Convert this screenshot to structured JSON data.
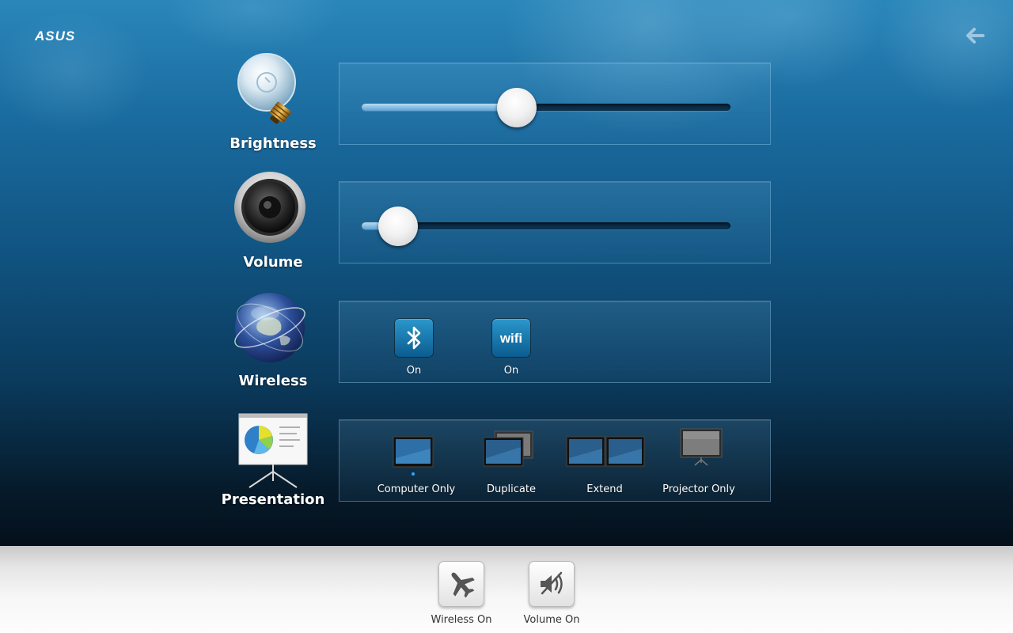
{
  "brand": {
    "logo_text": "ASUS"
  },
  "rows": {
    "brightness": {
      "label": "Brightness",
      "level_percent": 41
    },
    "volume": {
      "label": "Volume",
      "level_percent": 5
    },
    "wireless": {
      "label": "Wireless",
      "bluetooth": {
        "status": "On"
      },
      "wifi": {
        "icon_text": "wifi",
        "status": "On"
      }
    },
    "presentation": {
      "label": "Presentation",
      "modes": [
        "Computer Only",
        "Duplicate",
        "Extend",
        "Projector Only"
      ],
      "selected": "Computer Only"
    }
  },
  "bottom_bar": {
    "wireless_toggle_label": "Wireless On",
    "volume_toggle_label": "Volume On"
  },
  "icons": {
    "back": "arrow-left-icon",
    "brightness": "lightbulb-icon",
    "volume": "speaker-icon",
    "wireless": "globe-icon",
    "presentation": "projector-screen-icon",
    "bluetooth": "bluetooth-icon",
    "wifi": "wifi-icon",
    "airplane": "airplane-icon",
    "mute": "speaker-mute-icon"
  },
  "colors": {
    "accent": "#1a7fb8",
    "tile": "#0b5c8f",
    "text": "#ffffff"
  }
}
